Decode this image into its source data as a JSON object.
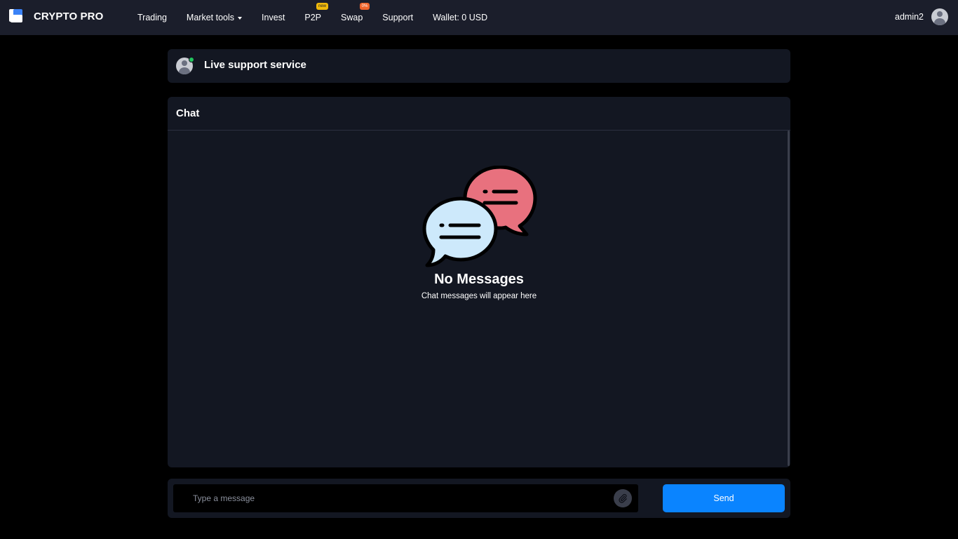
{
  "brand": {
    "name": "CRYPTO PRO",
    "logo_icon": "crypto-pro-logo-icon"
  },
  "nav": {
    "items": [
      {
        "label": "Trading"
      },
      {
        "label": "Market tools"
      },
      {
        "label": "Invest"
      },
      {
        "label": "P2P",
        "badge": "new"
      },
      {
        "label": "Swap",
        "badge": "0%"
      },
      {
        "label": "Support"
      },
      {
        "label": "Wallet: 0 USD"
      }
    ]
  },
  "user": {
    "name": "admin2",
    "avatar_icon": "user-avatar-icon"
  },
  "support": {
    "title": "Live support service",
    "status": "online"
  },
  "chat": {
    "title": "Chat",
    "empty_title": "No Messages",
    "empty_subtitle": "Chat messages will appear here",
    "empty_icon": "chat-bubbles-icon"
  },
  "composer": {
    "placeholder": "Type a message",
    "attach_icon": "paperclip-icon",
    "send_label": "Send"
  },
  "colors": {
    "page_bg": "#000000",
    "navbar_bg": "#1b1e2b",
    "panel_bg": "#131722",
    "accent": "#0a84ff",
    "online": "#22c55e",
    "badge_new": "#f0b90b",
    "badge_pct": "#f0642b",
    "bubble_pink": "#e8717e",
    "bubble_blue": "#cde9fb"
  }
}
